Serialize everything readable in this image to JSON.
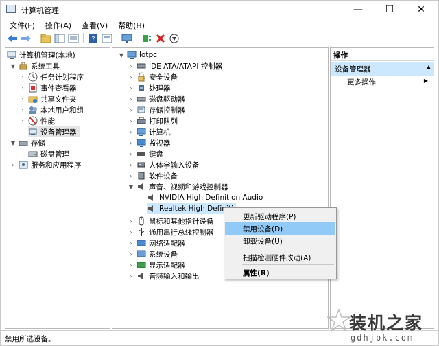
{
  "window": {
    "title": "计算机管理"
  },
  "window_controls": {
    "minimize": "—",
    "maximize": "☐",
    "close": "✕"
  },
  "menu": [
    "文件(F)",
    "操作(A)",
    "查看(V)",
    "帮助(H)"
  ],
  "left_tree": [
    {
      "label": "计算机管理(本地)",
      "icon": "computer-management-icon",
      "expander": ""
    },
    {
      "label": "系统工具",
      "icon": "tools-icon",
      "expander": "▼"
    },
    {
      "label": "任务计划程序",
      "icon": "clock-icon",
      "expander": "›"
    },
    {
      "label": "事件查看器",
      "icon": "event-viewer-icon",
      "expander": "›"
    },
    {
      "label": "共享文件夹",
      "icon": "shared-folder-icon",
      "expander": "›"
    },
    {
      "label": "本地用户和组",
      "icon": "users-icon",
      "expander": "›"
    },
    {
      "label": "性能",
      "icon": "performance-icon",
      "expander": "›"
    },
    {
      "label": "设备管理器",
      "icon": "device-manager-icon",
      "expander": ""
    },
    {
      "label": "存储",
      "icon": "storage-icon",
      "expander": "▼"
    },
    {
      "label": "磁盘管理",
      "icon": "disk-management-icon",
      "expander": ""
    },
    {
      "label": "服务和应用程序",
      "icon": "services-icon",
      "expander": "›"
    }
  ],
  "device_tree": {
    "root": "lotpc",
    "categories": [
      {
        "label": "IDE ATA/ATAPI 控制器",
        "icon": "ide-controller-icon",
        "expander": "›"
      },
      {
        "label": "安全设备",
        "icon": "security-device-icon",
        "expander": "›"
      },
      {
        "label": "处理器",
        "icon": "processor-icon",
        "expander": "›"
      },
      {
        "label": "磁盘驱动器",
        "icon": "disk-drive-icon",
        "expander": "›"
      },
      {
        "label": "存储控制器",
        "icon": "storage-controller-icon",
        "expander": "›"
      },
      {
        "label": "打印队列",
        "icon": "printer-icon",
        "expander": "›"
      },
      {
        "label": "计算机",
        "icon": "computer-icon",
        "expander": "›"
      },
      {
        "label": "监视器",
        "icon": "monitor-icon",
        "expander": "›"
      },
      {
        "label": "键盘",
        "icon": "keyboard-icon",
        "expander": "›"
      },
      {
        "label": "人体学输入设备",
        "icon": "hid-icon",
        "expander": "›"
      },
      {
        "label": "软件设备",
        "icon": "software-device-icon",
        "expander": "›"
      },
      {
        "label": "声音、视频和游戏控制器",
        "icon": "speaker-icon",
        "expander": "▼"
      }
    ],
    "audio_children": [
      "NVIDIA High Definition Audio",
      "Realtek High Definiti"
    ],
    "categories_after": [
      {
        "label": "鼠标和其他指针设备",
        "icon": "mouse-icon",
        "expander": "›"
      },
      {
        "label": "通用串行总线控制器",
        "icon": "usb-icon",
        "expander": "›"
      },
      {
        "label": "网络适配器",
        "icon": "network-adapter-icon",
        "expander": "›"
      },
      {
        "label": "系统设备",
        "icon": "system-device-icon",
        "expander": "›"
      },
      {
        "label": "显示适配器",
        "icon": "display-adapter-icon",
        "expander": "›"
      },
      {
        "label": "音频输入和输出",
        "icon": "audio-io-icon",
        "expander": "›"
      }
    ]
  },
  "actions_pane": {
    "header": "操作",
    "section": "设备管理器",
    "more": "更多操作"
  },
  "context_menu": {
    "items": [
      "更新驱动程序(P)",
      "禁用设备(D)",
      "卸载设备(U)",
      "扫描检测硬件改动(A)",
      "属性(R)"
    ],
    "highlighted": "禁用设备(D)"
  },
  "status": "禁用所选设备。",
  "watermark": {
    "title": "装机之家",
    "url": "gdhjbk.com"
  },
  "colors": {
    "selection": "#cce8ff",
    "menu_hover": "#91c9f7",
    "highlight_box": "#e02020"
  }
}
